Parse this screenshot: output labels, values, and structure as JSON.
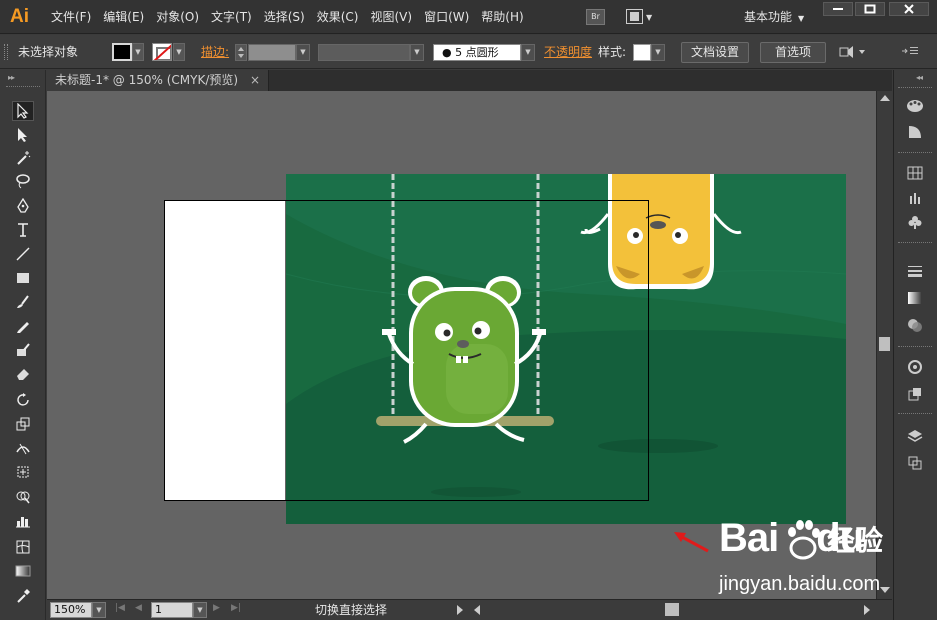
{
  "app": {
    "logo": "Ai"
  },
  "menu": {
    "items": [
      "文件(F)",
      "编辑(E)",
      "对象(O)",
      "文字(T)",
      "选择(S)",
      "效果(C)",
      "视图(V)",
      "窗口(W)",
      "帮助(H)"
    ],
    "bridge_label": "Br",
    "workspace": "基本功能"
  },
  "control": {
    "selection_status": "未选择对象",
    "stroke_label": "描边",
    "brush": "5 点圆形",
    "opacity_label": "不透明度",
    "style_label": "样式",
    "doc_setup": "文档设置",
    "preferences": "首选项"
  },
  "document": {
    "tab_title": "未标题-1* @ 150% (CMYK/预览)",
    "tab_close": "×"
  },
  "status": {
    "zoom": "150%",
    "page": "1",
    "text": "切换直接选择"
  },
  "watermark": {
    "logo_text": "Bai",
    "logo_text2": "du",
    "cn_text": "经验",
    "url": "jingyan.baidu.com"
  },
  "colors": {
    "artwork_bg": "#1b7049",
    "artwork_fg": "#145f3c",
    "monster_green": "#6aa834",
    "monster_yellow": "#f3c13a",
    "arrow": "#e01b1b",
    "accent_orange": "#f09030"
  }
}
